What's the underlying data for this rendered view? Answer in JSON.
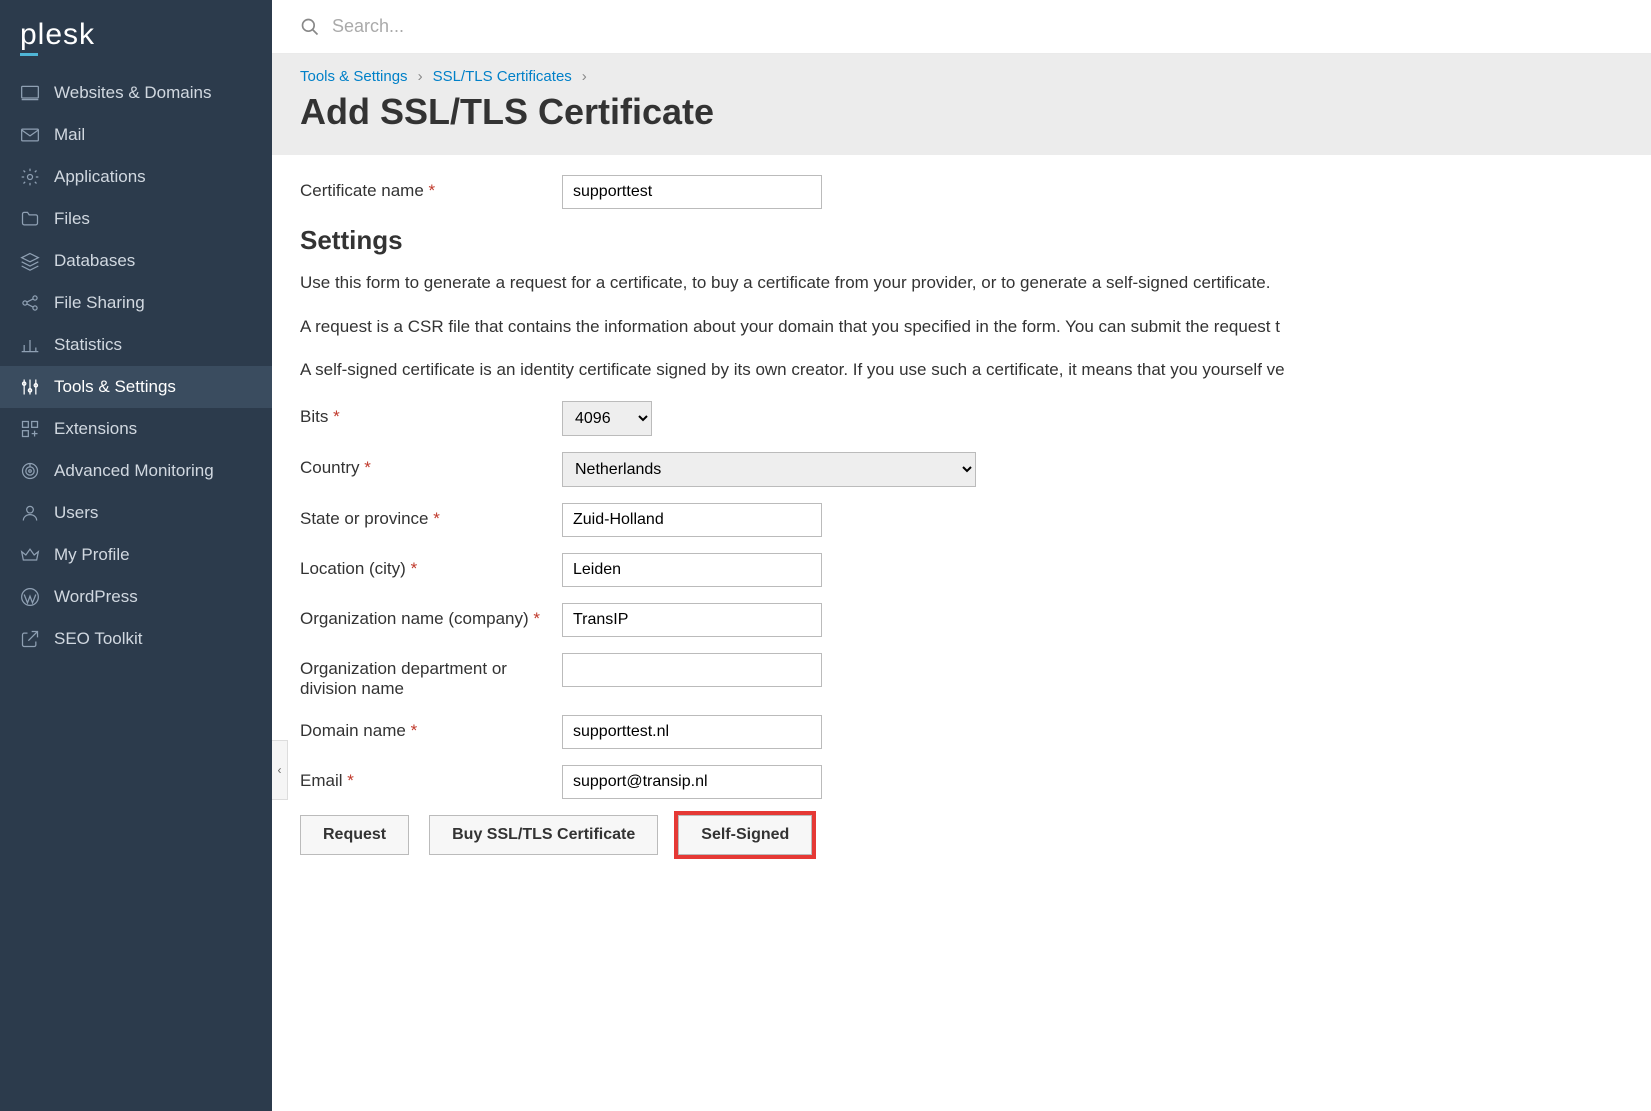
{
  "brand": "plesk",
  "search": {
    "placeholder": "Search..."
  },
  "sidebar": {
    "items": [
      {
        "label": "Websites & Domains",
        "icon": "monitor"
      },
      {
        "label": "Mail",
        "icon": "mail"
      },
      {
        "label": "Applications",
        "icon": "gear"
      },
      {
        "label": "Files",
        "icon": "folder"
      },
      {
        "label": "Databases",
        "icon": "layers"
      },
      {
        "label": "File Sharing",
        "icon": "share"
      },
      {
        "label": "Statistics",
        "icon": "bar-chart"
      },
      {
        "label": "Tools & Settings",
        "icon": "sliders",
        "active": true
      },
      {
        "label": "Extensions",
        "icon": "grid-plus"
      },
      {
        "label": "Advanced Monitoring",
        "icon": "radar"
      },
      {
        "label": "Users",
        "icon": "user"
      },
      {
        "label": "My Profile",
        "icon": "crown"
      },
      {
        "label": "WordPress",
        "icon": "wordpress"
      },
      {
        "label": "SEO Toolkit",
        "icon": "external"
      }
    ]
  },
  "breadcrumb": {
    "items": [
      {
        "label": "Tools & Settings"
      },
      {
        "label": "SSL/TLS Certificates"
      }
    ]
  },
  "page": {
    "title": "Add SSL/TLS Certificate"
  },
  "section": {
    "heading": "Settings",
    "p1": "Use this form to generate a request for a certificate, to buy a certificate from your provider, or to generate a self-signed certificate.",
    "p2": "A request is a CSR file that contains the information about your domain that you specified in the form. You can submit the request t",
    "p3": "A self-signed certificate is an identity certificate signed by its own creator. If you use such a certificate, it means that you yourself ve"
  },
  "form": {
    "cert_name": {
      "label": "Certificate name",
      "value": "supporttest"
    },
    "bits": {
      "label": "Bits",
      "value": "4096"
    },
    "country": {
      "label": "Country",
      "value": "Netherlands"
    },
    "state": {
      "label": "State or province",
      "value": "Zuid-Holland"
    },
    "city": {
      "label": "Location (city)",
      "value": "Leiden"
    },
    "org": {
      "label": "Organization name (company)",
      "value": "TransIP"
    },
    "dept": {
      "label": "Organization department or division name",
      "value": ""
    },
    "domain": {
      "label": "Domain name",
      "value": "supporttest.nl"
    },
    "email": {
      "label": "Email",
      "value": "support@transip.nl"
    }
  },
  "buttons": {
    "request": "Request",
    "buy": "Buy SSL/TLS Certificate",
    "self_signed": "Self-Signed"
  },
  "collapse_glyph": "‹"
}
